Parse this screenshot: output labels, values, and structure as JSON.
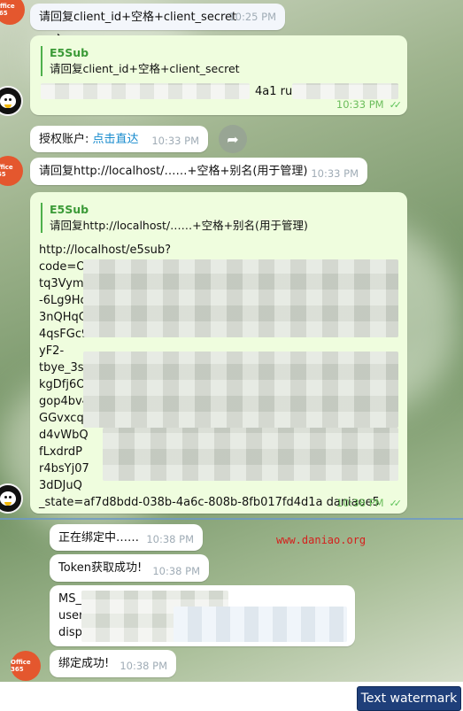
{
  "colors": {
    "accent_green": "#4eb04c",
    "link_blue": "#168acd",
    "watermark_red": "#d4201d",
    "button_navy": "#1f3f7a"
  },
  "messages": [
    {
      "text": "请回复client_id+空格+client_secret",
      "time": "10:25 PM"
    },
    {
      "quote_name": "E5Sub",
      "quote_text": "请回复client_id+空格+client_secret",
      "partial_a": "4a1 ru",
      "time": "10:33 PM"
    },
    {
      "prefix": "授权账户: ",
      "link": "点击直达",
      "time": "10:33 PM"
    },
    {
      "text": "请回复http://localhost/……+空格+别名(用于管理)",
      "time": "10:33 PM"
    },
    {
      "quote_name": "E5Sub",
      "quote_text": "请回复http://localhost/……+空格+别名(用于管理)",
      "lines": [
        "http://localhost/e5sub?",
        "code=OA",
        "tq3Vym",
        "-6Lg9Hc",
        "3nQHqC",
        "4qsFGc9",
        "yF2-",
        "tbye_3s",
        "kgDfj6O",
        "gop4bv4",
        "GGvxcq",
        "d4vWbQ",
        "fLxdrdP",
        "r4bsYj07",
        "3dDJuQ",
        "_state=af7d8bdd-038b-4a6c-808b-8fb017fd4d1a daniaoe5"
      ],
      "time": "10:38 PM"
    },
    {
      "text": "正在绑定中……",
      "time": "10:38 PM"
    },
    {
      "text": "Token获取成功!",
      "time": "10:38 PM"
    },
    {
      "lines": [
        "MS_",
        "user",
        "disp"
      ]
    },
    {
      "text": "绑定成功!",
      "time": "10:38 PM"
    }
  ],
  "avatars": {
    "office_label": "Office 365"
  },
  "watermark_site": "www.daniao.org",
  "watermark_button": "Text watermark"
}
